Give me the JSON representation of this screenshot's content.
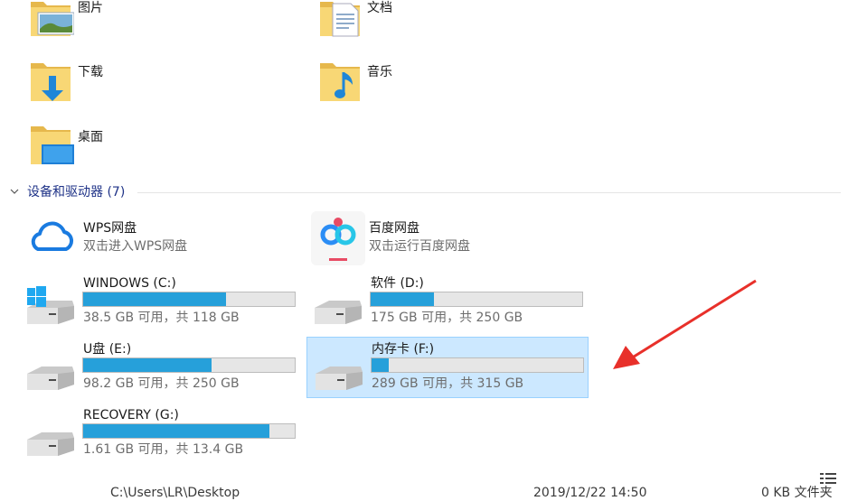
{
  "folders": [
    {
      "name": "图片",
      "icon": "pictures-folder-icon"
    },
    {
      "name": "文档",
      "icon": "documents-folder-icon"
    },
    {
      "name": "下载",
      "icon": "downloads-folder-icon"
    },
    {
      "name": "音乐",
      "icon": "music-folder-icon"
    },
    {
      "name": "桌面",
      "icon": "desktop-folder-icon"
    }
  ],
  "section": {
    "title": "设备和驱动器 (7)"
  },
  "apps": [
    {
      "title": "WPS网盘",
      "subtitle": "双击进入WPS网盘",
      "icon": "wps-cloud-icon"
    },
    {
      "title": "百度网盘",
      "subtitle": "双击运行百度网盘",
      "icon": "baidu-netdisk-icon"
    }
  ],
  "drives": [
    {
      "name": "WINDOWS (C:)",
      "info": "38.5 GB 可用，共 118 GB",
      "used_fraction": 0.674,
      "icon": "windows-drive-icon"
    },
    {
      "name": "软件 (D:)",
      "info": "175 GB 可用，共 250 GB",
      "used_fraction": 0.3,
      "icon": "hard-drive-icon"
    },
    {
      "name": "U盘 (E:)",
      "info": "98.2 GB 可用，共 250 GB",
      "used_fraction": 0.607,
      "icon": "hard-drive-icon"
    },
    {
      "name": "内存卡 (F:)",
      "info": "289 GB 可用，共 315 GB",
      "used_fraction": 0.083,
      "icon": "hard-drive-icon",
      "selected": true
    },
    {
      "name": "RECOVERY (G:)",
      "info": "1.61 GB 可用，共 13.4 GB",
      "used_fraction": 0.88,
      "icon": "hard-drive-icon"
    }
  ],
  "colors": {
    "accent": "#26a0da",
    "selection": "#cce8ff",
    "arrow": "#e8302a"
  },
  "bottom_partial": {
    "path": "C:\\Users\\LR\\Desktop",
    "date": "2019/12/22 14:50",
    "size": "0 KB 文件夹"
  }
}
